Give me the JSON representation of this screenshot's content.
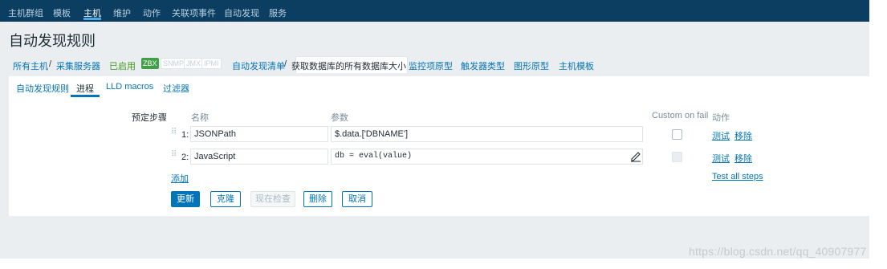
{
  "topnav": {
    "items": [
      "主机群组",
      "模板",
      "主机",
      "维护",
      "动作",
      "关联项事件",
      "自动发现",
      "服务"
    ],
    "active_index": 2
  },
  "page": {
    "title": "自动发现规则"
  },
  "breadcrumb": {
    "all_hosts": "所有主机",
    "separator": "/",
    "host": "采集服务器",
    "status": "已启用",
    "badges": [
      "ZBX",
      "SNMP",
      "JMX",
      "IPMI"
    ],
    "discovery_list": "自动发现清单",
    "current_rule": "获取数据库的所有数据库大小",
    "item_prototypes": "监控项原型",
    "trigger_types": "触发器类型",
    "graph_prototypes": "图形原型",
    "host_templates": "主机模板"
  },
  "tabs": {
    "items": [
      "自动发现规则",
      "进程",
      "LLD macros",
      "过滤器"
    ],
    "active": "进程"
  },
  "preprocessing": {
    "label": "预定步骤",
    "headers": {
      "name": "名称",
      "params": "参数",
      "custom_on_fail": "Custom on fail",
      "actions": "动作"
    },
    "steps": [
      {
        "number": "1:",
        "name": "JSONPath",
        "param": "$.data.['DBNAME']",
        "test": "测试",
        "remove": "移除",
        "custom_on_fail_enabled": true
      },
      {
        "number": "2:",
        "name": "JavaScript",
        "param": "db = eval(value)",
        "test": "测试",
        "remove": "移除",
        "custom_on_fail_enabled": false
      }
    ],
    "add": "添加",
    "test_all": "Test all steps"
  },
  "buttons": {
    "update": "更新",
    "clone": "克隆",
    "check_now": "现在检查",
    "delete": "删除",
    "cancel": "取消"
  },
  "watermark": "https://blog.csdn.net/qq_40907977",
  "colors": {
    "nav": "#0b3e61",
    "link": "#0275b8",
    "enabled": "#3e9b17",
    "zbx_badge": "#429e47"
  }
}
